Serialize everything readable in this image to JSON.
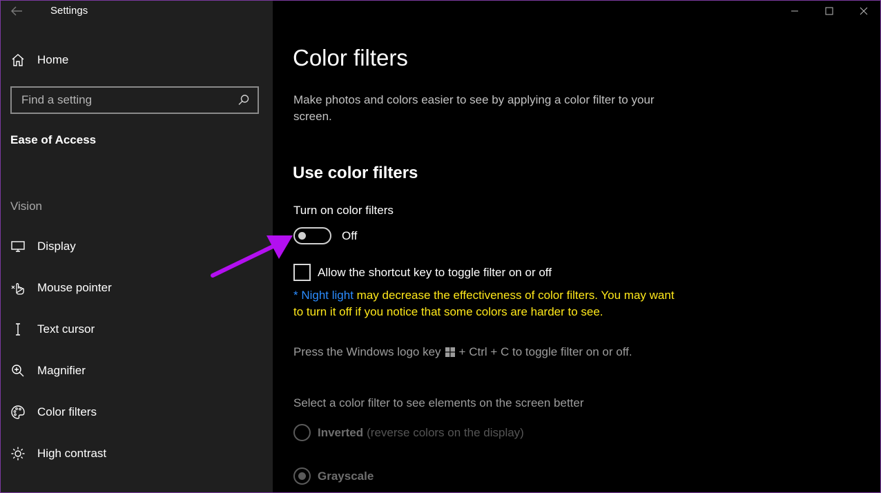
{
  "window": {
    "title": "Settings"
  },
  "sidebar": {
    "home_label": "Home",
    "search_placeholder": "Find a setting",
    "section_title": "Ease of Access",
    "group_label": "Vision",
    "items": [
      {
        "label": "Display",
        "icon": "monitor-icon"
      },
      {
        "label": "Mouse pointer",
        "icon": "mouse-pointer-icon"
      },
      {
        "label": "Text cursor",
        "icon": "text-cursor-icon"
      },
      {
        "label": "Magnifier",
        "icon": "magnifier-icon"
      },
      {
        "label": "Color filters",
        "icon": "palette-icon"
      },
      {
        "label": "High contrast",
        "icon": "sun-icon"
      }
    ]
  },
  "main": {
    "title": "Color filters",
    "description": "Make photos and colors easier to see by applying a color filter to your screen.",
    "section_title": "Use color filters",
    "toggle_label": "Turn on color filters",
    "toggle_state": "Off",
    "toggle_on": false,
    "checkbox_label": "Allow the shortcut key to toggle filter on or off",
    "checkbox_checked": false,
    "note_prefix": "* ",
    "note_link": "Night light",
    "note_text": " may decrease the effectiveness of color filters. You may want to turn it off if you notice that some colors are harder to see.",
    "shortcut_prefix": "Press the Windows logo key",
    "shortcut_suffix": "+ Ctrl + C to toggle filter on or off.",
    "select_label": "Select a color filter to see elements on the screen better",
    "filters": [
      {
        "name": "Inverted",
        "desc": "(reverse colors on the display)",
        "selected": false
      },
      {
        "name": "Grayscale",
        "desc": "",
        "selected": true
      }
    ]
  },
  "colors": {
    "sidebar_bg": "#1f1f1f",
    "main_bg": "#000000",
    "note_text": "#ffe81a",
    "link": "#2b8cff",
    "annotation_arrow": "#b30ff0"
  }
}
